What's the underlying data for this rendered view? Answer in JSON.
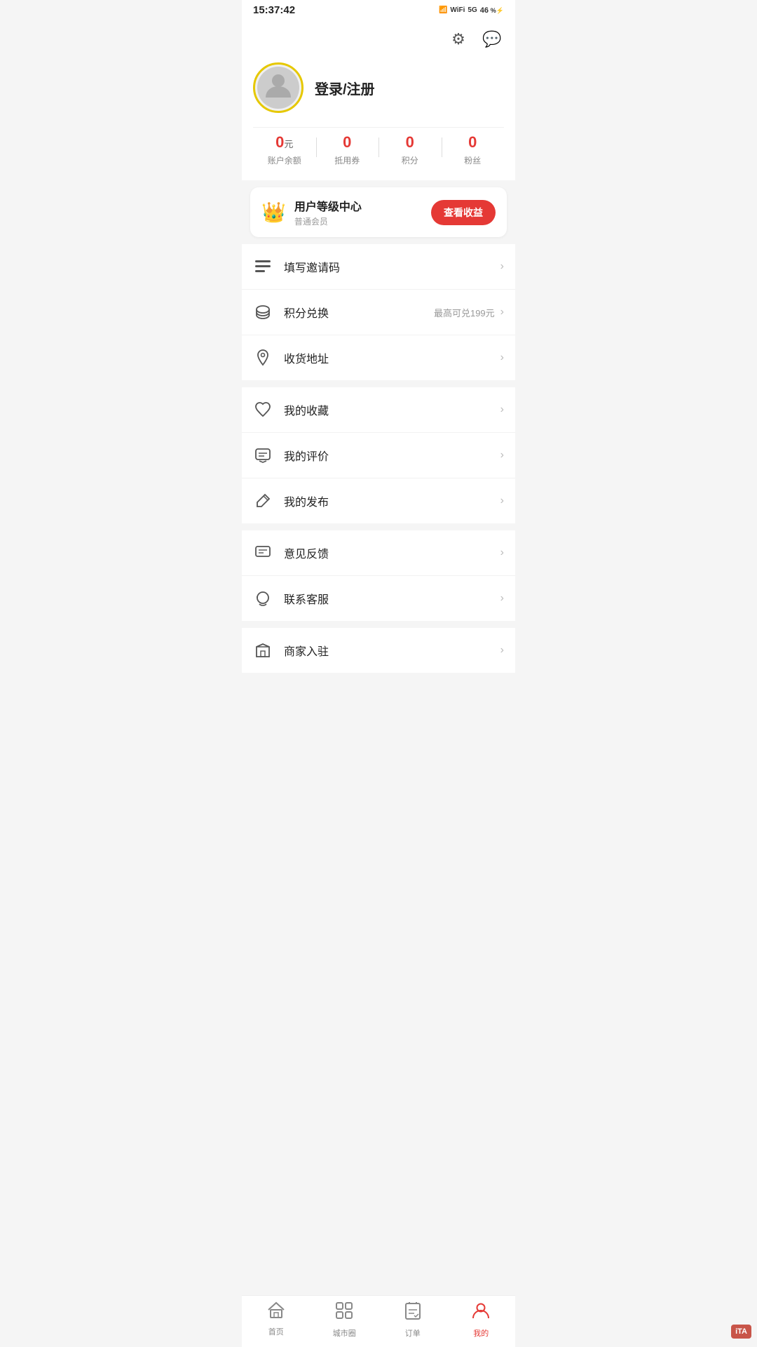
{
  "statusBar": {
    "time": "15:37:42",
    "network": "5G",
    "battery": "46"
  },
  "header": {
    "settingsIcon": "⚙",
    "messageIcon": "💬"
  },
  "user": {
    "loginLabel": "登录/注册",
    "avatarAlt": "用户头像"
  },
  "stats": [
    {
      "value": "0",
      "unit": "元",
      "label": "账户余额"
    },
    {
      "value": "0",
      "unit": "",
      "label": "抵用券"
    },
    {
      "value": "0",
      "unit": "",
      "label": "积分"
    },
    {
      "value": "0",
      "unit": "",
      "label": "粉丝"
    }
  ],
  "memberCard": {
    "crownIcon": "👑",
    "title": "用户等级中心",
    "subtitle": "普通会员",
    "btnLabel": "查看收益"
  },
  "menuSections": [
    {
      "items": [
        {
          "icon": "≡",
          "iconType": "list",
          "label": "填写邀请码",
          "sub": "",
          "id": "invite-code"
        },
        {
          "icon": "🗄",
          "iconType": "database",
          "label": "积分兑换",
          "sub": "最高可兑199元",
          "id": "points-exchange"
        },
        {
          "icon": "📍",
          "iconType": "location",
          "label": "收货地址",
          "sub": "",
          "id": "shipping-address"
        }
      ]
    },
    {
      "items": [
        {
          "icon": "☆",
          "iconType": "star",
          "label": "我的收藏",
          "sub": "",
          "id": "my-favorites"
        },
        {
          "icon": "💬",
          "iconType": "comment",
          "label": "我的评价",
          "sub": "",
          "id": "my-reviews"
        },
        {
          "icon": "✏",
          "iconType": "edit",
          "label": "我的发布",
          "sub": "",
          "id": "my-posts"
        }
      ]
    },
    {
      "items": [
        {
          "icon": "📋",
          "iconType": "feedback",
          "label": "意见反馈",
          "sub": "",
          "id": "feedback"
        },
        {
          "icon": "💬",
          "iconType": "service",
          "label": "联系客服",
          "sub": "",
          "id": "customer-service"
        }
      ]
    },
    {
      "items": [
        {
          "icon": "🚩",
          "iconType": "flag",
          "label": "商家入驻",
          "sub": "",
          "id": "merchant-join"
        }
      ]
    }
  ],
  "tabBar": {
    "tabs": [
      {
        "id": "home",
        "icon": "🏠",
        "label": "首页",
        "active": false
      },
      {
        "id": "city-circle",
        "icon": "⠿",
        "label": "城市圈",
        "active": false
      },
      {
        "id": "orders",
        "icon": "🗒",
        "label": "订单",
        "active": false
      },
      {
        "id": "mine",
        "icon": "👤",
        "label": "我的",
        "active": true
      }
    ]
  },
  "watermark": "iTA"
}
